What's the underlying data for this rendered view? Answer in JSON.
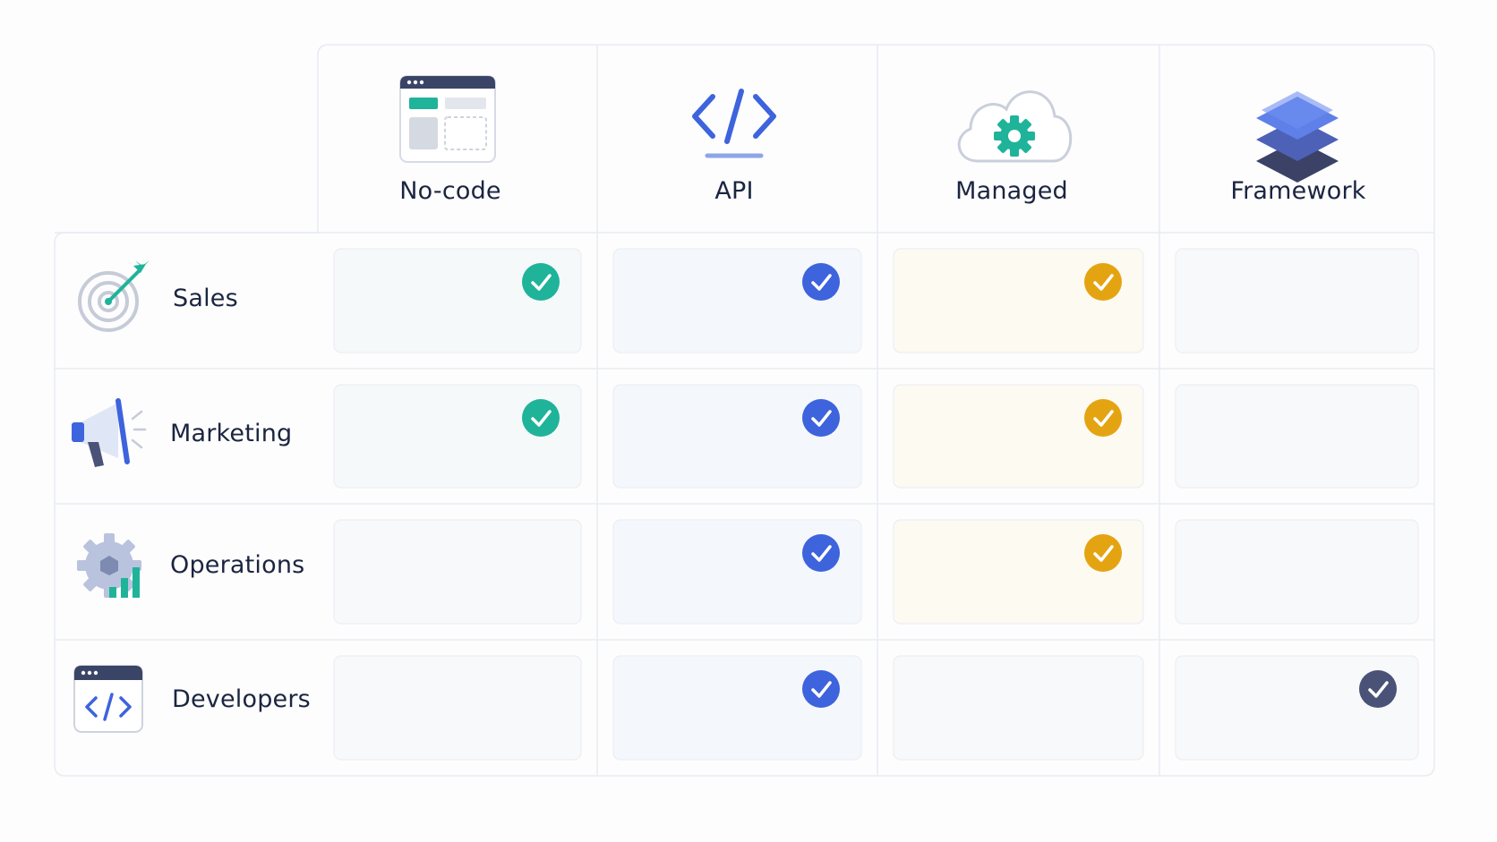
{
  "columns": [
    {
      "label": "No-code",
      "icon": "web-builder-icon",
      "accent": "#1fb39a",
      "tint": "#f5f9fa"
    },
    {
      "label": "API",
      "icon": "code-icon",
      "accent": "#3d63dd",
      "tint": "#f4f7fc"
    },
    {
      "label": "Managed",
      "icon": "cloud-gear-icon",
      "accent": "#e4a412",
      "tint": "#fdfaf2"
    },
    {
      "label": "Framework",
      "icon": "layers-icon",
      "accent": "#4a5278",
      "tint": "#f8f9fa"
    }
  ],
  "rows": [
    {
      "label": "Sales",
      "icon": "target-icon",
      "checks": [
        true,
        true,
        true,
        false
      ]
    },
    {
      "label": "Marketing",
      "icon": "megaphone-icon",
      "checks": [
        true,
        true,
        true,
        false
      ]
    },
    {
      "label": "Operations",
      "icon": "gear-chart-icon",
      "checks": [
        false,
        true,
        true,
        false
      ]
    },
    {
      "label": "Developers",
      "icon": "code-window-icon",
      "checks": [
        false,
        true,
        false,
        true
      ]
    }
  ],
  "colors": {
    "text": "#1b2540",
    "grid_line": "#e8ebf1",
    "empty_cell": "#f8f9fa"
  }
}
